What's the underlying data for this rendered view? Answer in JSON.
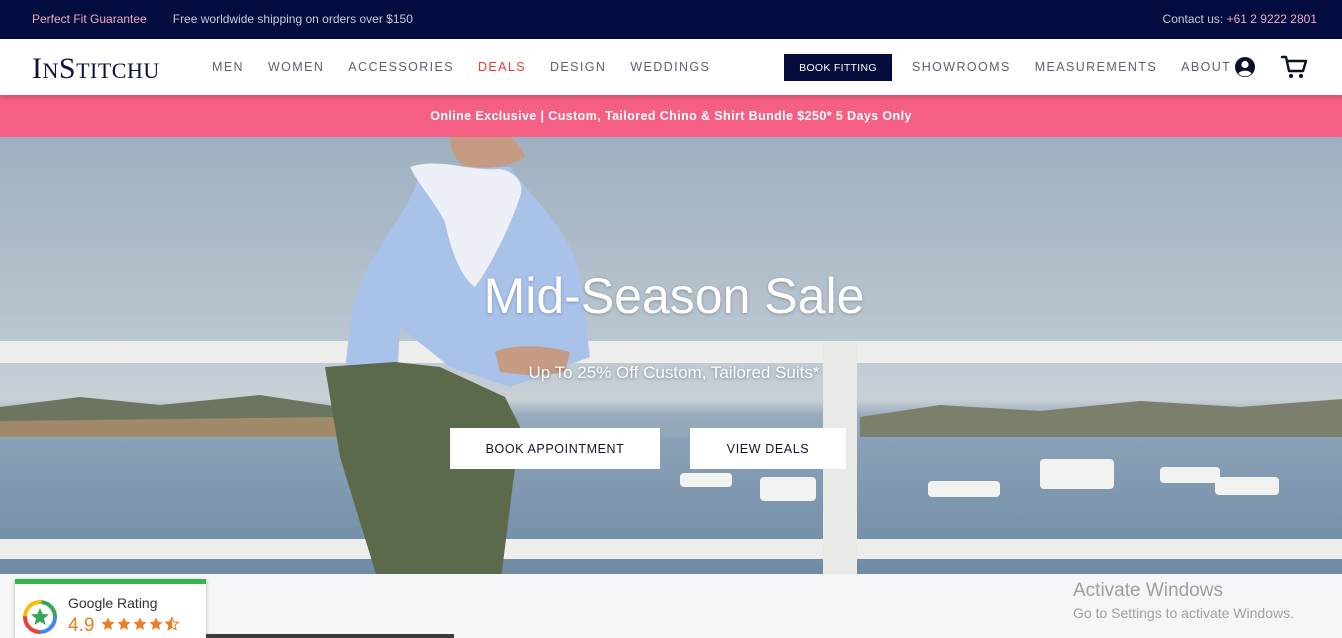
{
  "topbar": {
    "guarantee": "Perfect Fit Guarantee",
    "shipping": "Free worldwide shipping on orders over $150",
    "contact_label": "Contact us:",
    "phone": "+61 2 9222 2801"
  },
  "nav": {
    "logo": {
      "first_big": "I",
      "first_small": "N",
      "second_big": "S",
      "second_small": "TITCHU"
    },
    "menu": [
      "MEN",
      "WOMEN",
      "ACCESSORIES",
      "DEALS",
      "DESIGN",
      "WEDDINGS"
    ],
    "book_fitting": "BOOK FITTING",
    "menu_right": [
      "SHOWROOMS",
      "MEASUREMENTS",
      "ABOUT"
    ],
    "icons": [
      "user-icon",
      "cart-icon"
    ]
  },
  "promo": {
    "text": "Online Exclusive | Custom, Tailored Chino & Shirt Bundle $250* 5 Days Only"
  },
  "hero": {
    "title": "Mid-Season Sale",
    "subtitle": "Up To 25% Off Custom, Tailored Suits*",
    "button_book": "BOOK APPOINTMENT",
    "button_deals": "VIEW DEALS"
  },
  "rating": {
    "label": "Google Rating",
    "score": "4.9",
    "stars": 4.5
  },
  "watermark": {
    "line1": "Activate Windows",
    "line2": "Go to Settings to activate Windows."
  },
  "colors": {
    "navy": "#020c3e",
    "pink": "#f55f83",
    "deals_red": "#e13a3a",
    "rating_green": "#35b44a",
    "rating_orange": "#e87c1e"
  }
}
